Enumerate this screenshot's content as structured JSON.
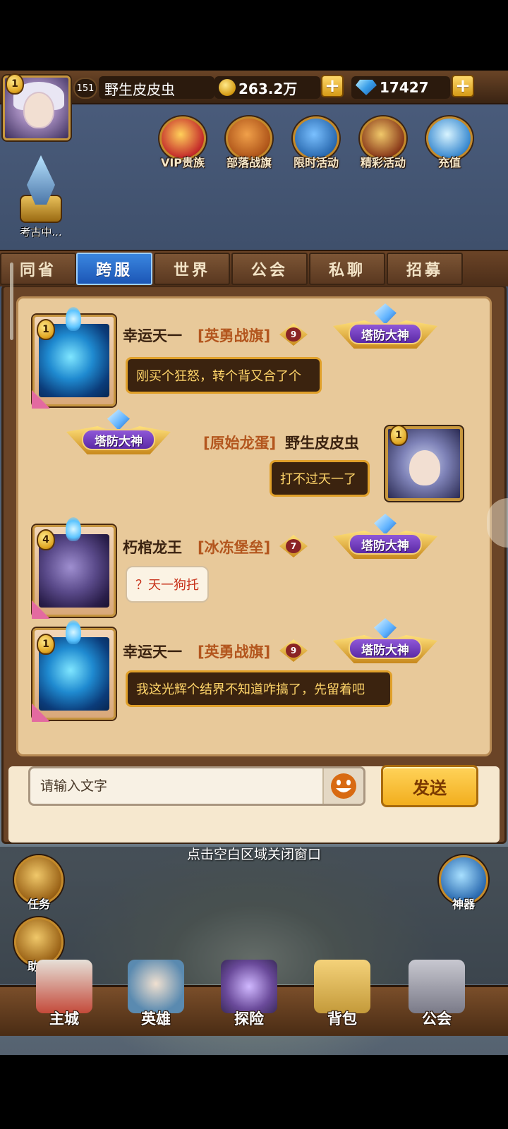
{
  "player": {
    "level": "151",
    "rank": "1",
    "name": "野生皮皮虫"
  },
  "resources": {
    "gold": "263.2万",
    "gems": "17427"
  },
  "top_icons": [
    {
      "name": "vip-nobility",
      "label": "VIP贵族",
      "color": "#c42a2a"
    },
    {
      "name": "tribe-banner",
      "label": "部落战旗",
      "color": "#b0561a"
    },
    {
      "name": "limited-event",
      "label": "限时活动",
      "color": "#2a6ab0"
    },
    {
      "name": "featured-event",
      "label": "精彩活动",
      "color": "#8a3a1a"
    },
    {
      "name": "recharge",
      "label": "充值",
      "color": "#3a8ad0"
    }
  ],
  "archaeology": {
    "label": "考古中..."
  },
  "tabs": [
    {
      "label": "同省"
    },
    {
      "label": "跨服"
    },
    {
      "label": "世界"
    },
    {
      "label": "公会"
    },
    {
      "label": "私聊"
    },
    {
      "label": "招募"
    }
  ],
  "active_tab": "跨服",
  "messages": [
    {
      "rank": "1",
      "name": "幸运天一",
      "guild": "[英勇战旗]",
      "vip": "9",
      "title": "塔防大神",
      "text": "刚买个狂怒，转个背又合了个"
    },
    {
      "rank": "1",
      "name": "野生皮皮虫",
      "guild": "[原始龙蛋]",
      "title": "塔防大神",
      "text": "打不过天一了"
    },
    {
      "rank": "4",
      "name": "朽棺龙王",
      "guild": "[冰冻堡垒]",
      "vip": "7",
      "title": "塔防大神",
      "text": "？天一狗托"
    },
    {
      "rank": "1",
      "name": "幸运天一",
      "guild": "[英勇战旗]",
      "vip": "9",
      "title": "塔防大神",
      "text": "我这光辉个结界不知道咋搞了，先留着吧"
    }
  ],
  "input": {
    "placeholder": "请输入文字",
    "send_label": "发送"
  },
  "close_hint": "点击空白区域关闭窗口",
  "side_buttons": {
    "task": "任务",
    "helper": "助手",
    "artifact": "神器"
  },
  "bottom_nav": [
    {
      "label": "主城",
      "color": "#c44a3a"
    },
    {
      "label": "英雄",
      "color": "#5a8ab0"
    },
    {
      "label": "探险",
      "color": "#6a4a9a"
    },
    {
      "label": "背包",
      "color": "#c49a3a"
    },
    {
      "label": "公会",
      "color": "#7a7a88"
    }
  ]
}
